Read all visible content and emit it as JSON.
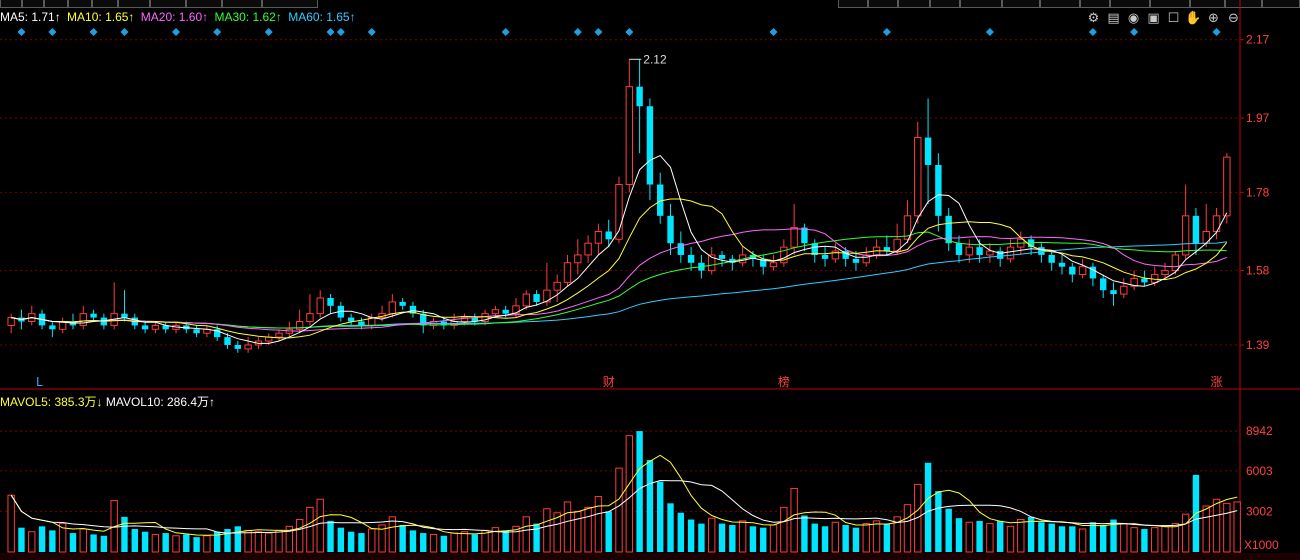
{
  "legend": {
    "ma5": "MA5: 1.71↑",
    "ma10": "MA10: 1.65↑",
    "ma20": "MA20: 1.60↑",
    "ma30": "MA30: 1.62↑",
    "ma60": "MA60: 1.65↑"
  },
  "vol_legend": {
    "mavol5": "MAVOL5: 385.3万↓",
    "mavol10": "MAVOL10: 286.4万↑"
  },
  "colors": {
    "up": "#ff3b3b",
    "down": "#00e5ff",
    "ma5": "#ffffff",
    "ma10": "#ffff33",
    "ma20": "#ff66ff",
    "ma30": "#33ff33",
    "ma60": "#33ccff",
    "axis": "#c00000"
  },
  "icons": [
    "settings-icon",
    "layers-icon",
    "eye-icon",
    "gift-icon",
    "share-icon",
    "hand-icon",
    "zoom-in-icon",
    "zoom-out-icon"
  ],
  "chart_data": [
    {
      "type": "candlestick",
      "title": "",
      "ylim": [
        1.28,
        2.2
      ],
      "y_ticks": [
        1.39,
        1.58,
        1.78,
        1.97,
        2.17
      ],
      "y_tick_labels": [
        "1.39",
        "1.58",
        "1.78",
        "1.97",
        "2.17"
      ],
      "max_label": "2.12",
      "markers": [
        {
          "index": 63,
          "text": "财"
        },
        {
          "index": 82,
          "text": "榜"
        },
        {
          "index": 128,
          "text": "涨"
        },
        {
          "index": 3,
          "text": "L"
        }
      ],
      "candles": [
        [
          1.44,
          1.46,
          1.42,
          1.47
        ],
        [
          1.46,
          1.45,
          1.43,
          1.48
        ],
        [
          1.45,
          1.47,
          1.44,
          1.49
        ],
        [
          1.47,
          1.44,
          1.43,
          1.48
        ],
        [
          1.44,
          1.43,
          1.41,
          1.45
        ],
        [
          1.43,
          1.45,
          1.42,
          1.46
        ],
        [
          1.45,
          1.44,
          1.43,
          1.47
        ],
        [
          1.44,
          1.47,
          1.43,
          1.49
        ],
        [
          1.47,
          1.46,
          1.45,
          1.48
        ],
        [
          1.46,
          1.44,
          1.43,
          1.47
        ],
        [
          1.44,
          1.47,
          1.43,
          1.55
        ],
        [
          1.47,
          1.46,
          1.45,
          1.53
        ],
        [
          1.46,
          1.44,
          1.43,
          1.47
        ],
        [
          1.44,
          1.43,
          1.42,
          1.45
        ],
        [
          1.43,
          1.44,
          1.42,
          1.45
        ],
        [
          1.44,
          1.43,
          1.42,
          1.45
        ],
        [
          1.43,
          1.44,
          1.42,
          1.45
        ],
        [
          1.44,
          1.43,
          1.42,
          1.45
        ],
        [
          1.43,
          1.42,
          1.41,
          1.44
        ],
        [
          1.42,
          1.43,
          1.41,
          1.44
        ],
        [
          1.43,
          1.41,
          1.4,
          1.44
        ],
        [
          1.41,
          1.39,
          1.38,
          1.42
        ],
        [
          1.39,
          1.38,
          1.37,
          1.4
        ],
        [
          1.38,
          1.39,
          1.37,
          1.41
        ],
        [
          1.39,
          1.4,
          1.38,
          1.41
        ],
        [
          1.4,
          1.41,
          1.39,
          1.42
        ],
        [
          1.41,
          1.42,
          1.4,
          1.43
        ],
        [
          1.42,
          1.43,
          1.41,
          1.45
        ],
        [
          1.43,
          1.45,
          1.42,
          1.48
        ],
        [
          1.45,
          1.47,
          1.44,
          1.52
        ],
        [
          1.47,
          1.51,
          1.46,
          1.53
        ],
        [
          1.51,
          1.49,
          1.47,
          1.52
        ],
        [
          1.49,
          1.46,
          1.45,
          1.5
        ],
        [
          1.46,
          1.45,
          1.44,
          1.47
        ],
        [
          1.45,
          1.44,
          1.43,
          1.46
        ],
        [
          1.44,
          1.46,
          1.43,
          1.47
        ],
        [
          1.46,
          1.47,
          1.45,
          1.49
        ],
        [
          1.47,
          1.5,
          1.46,
          1.52
        ],
        [
          1.5,
          1.49,
          1.48,
          1.51
        ],
        [
          1.49,
          1.47,
          1.46,
          1.5
        ],
        [
          1.47,
          1.44,
          1.42,
          1.48
        ],
        [
          1.44,
          1.45,
          1.43,
          1.46
        ],
        [
          1.45,
          1.44,
          1.43,
          1.46
        ],
        [
          1.44,
          1.45,
          1.43,
          1.47
        ],
        [
          1.45,
          1.46,
          1.44,
          1.47
        ],
        [
          1.46,
          1.45,
          1.44,
          1.47
        ],
        [
          1.45,
          1.47,
          1.44,
          1.48
        ],
        [
          1.47,
          1.48,
          1.46,
          1.49
        ],
        [
          1.48,
          1.47,
          1.46,
          1.49
        ],
        [
          1.47,
          1.49,
          1.46,
          1.51
        ],
        [
          1.49,
          1.52,
          1.48,
          1.53
        ],
        [
          1.52,
          1.5,
          1.49,
          1.53
        ],
        [
          1.5,
          1.53,
          1.49,
          1.6
        ],
        [
          1.53,
          1.55,
          1.5,
          1.57
        ],
        [
          1.55,
          1.6,
          1.54,
          1.62
        ],
        [
          1.6,
          1.62,
          1.57,
          1.66
        ],
        [
          1.62,
          1.65,
          1.6,
          1.67
        ],
        [
          1.65,
          1.68,
          1.62,
          1.7
        ],
        [
          1.68,
          1.66,
          1.64,
          1.71
        ],
        [
          1.66,
          1.8,
          1.65,
          1.82
        ],
        [
          1.8,
          2.05,
          1.78,
          2.12
        ],
        [
          2.05,
          2.0,
          1.88,
          2.12
        ],
        [
          2.0,
          1.8,
          1.76,
          2.02
        ],
        [
          1.8,
          1.72,
          1.7,
          1.83
        ],
        [
          1.72,
          1.65,
          1.62,
          1.75
        ],
        [
          1.65,
          1.62,
          1.6,
          1.68
        ],
        [
          1.62,
          1.6,
          1.58,
          1.64
        ],
        [
          1.6,
          1.58,
          1.56,
          1.62
        ],
        [
          1.58,
          1.62,
          1.57,
          1.64
        ],
        [
          1.62,
          1.61,
          1.59,
          1.63
        ],
        [
          1.61,
          1.6,
          1.58,
          1.62
        ],
        [
          1.6,
          1.62,
          1.59,
          1.64
        ],
        [
          1.62,
          1.61,
          1.59,
          1.63
        ],
        [
          1.61,
          1.59,
          1.57,
          1.62
        ],
        [
          1.59,
          1.6,
          1.58,
          1.62
        ],
        [
          1.6,
          1.64,
          1.59,
          1.66
        ],
        [
          1.64,
          1.69,
          1.62,
          1.75
        ],
        [
          1.69,
          1.65,
          1.63,
          1.7
        ],
        [
          1.65,
          1.62,
          1.6,
          1.66
        ],
        [
          1.62,
          1.61,
          1.59,
          1.64
        ],
        [
          1.61,
          1.63,
          1.6,
          1.65
        ],
        [
          1.63,
          1.61,
          1.59,
          1.64
        ],
        [
          1.61,
          1.6,
          1.58,
          1.63
        ],
        [
          1.6,
          1.62,
          1.59,
          1.64
        ],
        [
          1.62,
          1.64,
          1.61,
          1.66
        ],
        [
          1.64,
          1.63,
          1.62,
          1.67
        ],
        [
          1.63,
          1.66,
          1.62,
          1.7
        ],
        [
          1.66,
          1.72,
          1.65,
          1.76
        ],
        [
          1.72,
          1.92,
          1.7,
          1.96
        ],
        [
          1.92,
          1.85,
          1.75,
          2.02
        ],
        [
          1.85,
          1.72,
          1.68,
          1.88
        ],
        [
          1.72,
          1.65,
          1.63,
          1.74
        ],
        [
          1.65,
          1.62,
          1.6,
          1.67
        ],
        [
          1.62,
          1.64,
          1.6,
          1.66
        ],
        [
          1.64,
          1.62,
          1.6,
          1.66
        ],
        [
          1.62,
          1.63,
          1.6,
          1.65
        ],
        [
          1.63,
          1.61,
          1.59,
          1.64
        ],
        [
          1.61,
          1.64,
          1.6,
          1.66
        ],
        [
          1.64,
          1.66,
          1.62,
          1.68
        ],
        [
          1.66,
          1.64,
          1.62,
          1.67
        ],
        [
          1.64,
          1.62,
          1.6,
          1.65
        ],
        [
          1.62,
          1.6,
          1.58,
          1.63
        ],
        [
          1.6,
          1.59,
          1.57,
          1.62
        ],
        [
          1.59,
          1.57,
          1.55,
          1.6
        ],
        [
          1.57,
          1.59,
          1.56,
          1.61
        ],
        [
          1.59,
          1.56,
          1.54,
          1.6
        ],
        [
          1.56,
          1.53,
          1.51,
          1.57
        ],
        [
          1.53,
          1.52,
          1.49,
          1.55
        ],
        [
          1.52,
          1.54,
          1.51,
          1.56
        ],
        [
          1.54,
          1.56,
          1.53,
          1.58
        ],
        [
          1.56,
          1.55,
          1.54,
          1.58
        ],
        [
          1.55,
          1.57,
          1.54,
          1.59
        ],
        [
          1.57,
          1.58,
          1.56,
          1.6
        ],
        [
          1.58,
          1.62,
          1.57,
          1.63
        ],
        [
          1.62,
          1.72,
          1.61,
          1.8
        ],
        [
          1.72,
          1.65,
          1.62,
          1.74
        ],
        [
          1.65,
          1.68,
          1.64,
          1.75
        ],
        [
          1.68,
          1.72,
          1.66,
          1.74
        ],
        [
          1.72,
          1.87,
          1.7,
          1.88
        ]
      ]
    },
    {
      "type": "bar",
      "title": "",
      "unit_label": "X1000",
      "ylim": [
        0,
        10500
      ],
      "y_ticks": [
        3002,
        6003,
        8942
      ],
      "y_tick_labels": [
        "3002",
        "6003",
        "8942"
      ],
      "volumes": [
        4200,
        1800,
        1500,
        1900,
        1600,
        2100,
        1400,
        1700,
        1300,
        1200,
        3800,
        2600,
        1700,
        1500,
        1300,
        1400,
        1200,
        1300,
        1100,
        1200,
        1500,
        1700,
        1900,
        1600,
        1500,
        1400,
        1600,
        1900,
        2400,
        3300,
        3900,
        2300,
        1800,
        1500,
        1400,
        1700,
        2000,
        2600,
        2000,
        1600,
        1400,
        1300,
        1200,
        1400,
        1500,
        1300,
        1600,
        1800,
        1600,
        1900,
        2600,
        2100,
        3200,
        2900,
        3700,
        3000,
        3300,
        4100,
        3000,
        6200,
        8600,
        8942,
        6800,
        5200,
        3600,
        2900,
        2400,
        2100,
        2500,
        2100,
        2000,
        2300,
        1900,
        1800,
        2000,
        3300,
        4700,
        2700,
        2100,
        1900,
        2200,
        2000,
        1800,
        2100,
        2300,
        2100,
        2600,
        3500,
        5000,
        6600,
        4500,
        3200,
        2500,
        2200,
        2300,
        2100,
        2300,
        1900,
        2400,
        2600,
        2200,
        2100,
        1900,
        1900,
        1700,
        2200,
        2000,
        2400,
        2100,
        1800,
        1700,
        1800,
        1900,
        2100,
        2800,
        5700,
        3400,
        3900,
        3600,
        3700
      ]
    }
  ]
}
